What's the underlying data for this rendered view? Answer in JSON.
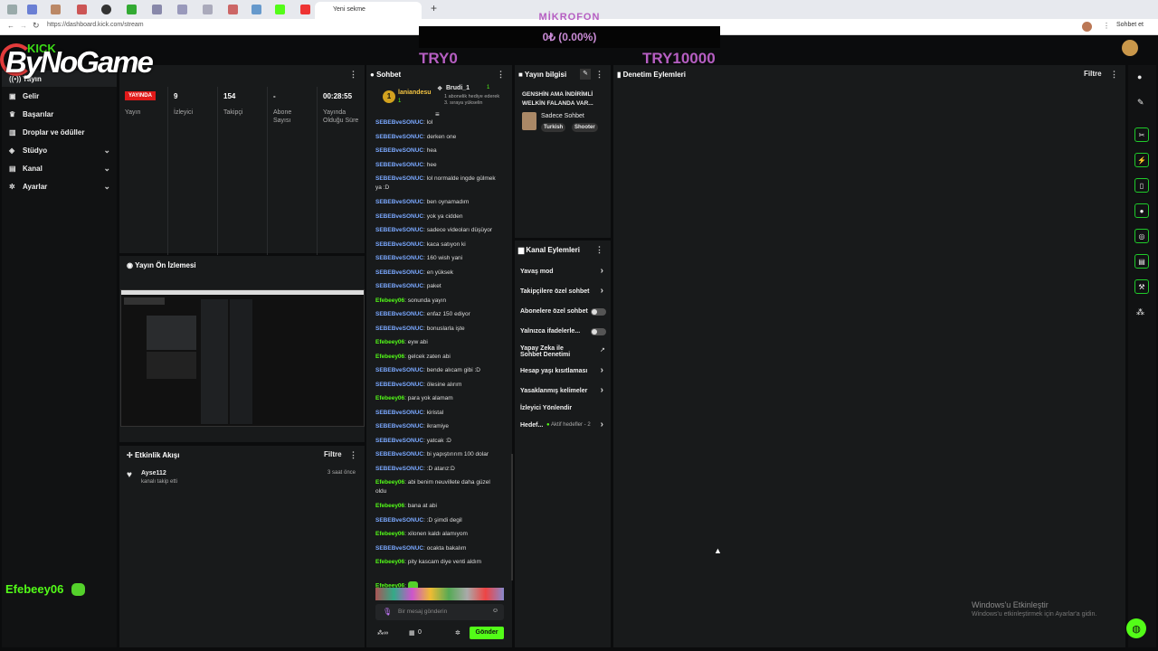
{
  "browser": {
    "active_tab": "Yeni sekme",
    "url": "https://dashboard.kick.com/stream",
    "profile_button": "Sohbet et"
  },
  "overlay": {
    "mikrofon": "MİKROFON",
    "progress_text": "0₺ (0.00%)",
    "progress": 0,
    "min": "TRY0",
    "max": "TRY10000",
    "logo": "ByNoGame",
    "logo_small": "KICK"
  },
  "sidebar": {
    "items": [
      {
        "label": "Yayın",
        "icon": "broadcast-icon"
      },
      {
        "label": "Gelir",
        "icon": "money-icon"
      },
      {
        "label": "Başarılar",
        "icon": "trophy-icon"
      },
      {
        "label": "Droplar ve ödüller",
        "icon": "gift-icon"
      },
      {
        "label": "Stüdyo",
        "icon": "studio-icon"
      },
      {
        "label": "Kanal",
        "icon": "channel-icon"
      },
      {
        "label": "Ayarlar",
        "icon": "gear-icon"
      }
    ],
    "user": "Efebeey06"
  },
  "stats": {
    "live_badge": "YAYINDA",
    "broadcast_label": "Yayın",
    "viewers": "9",
    "viewers_label": "İzleyici",
    "followers": "154",
    "followers_label": "Takipçi",
    "subs": "-",
    "subs_label": "Abone Sayısı",
    "duration": "00:28:55",
    "duration_label": "Yayında Olduğu Süre"
  },
  "preview": {
    "title": "Yayın Ön İzlemesi"
  },
  "activity": {
    "title": "Etkinlik Akışı",
    "filter": "Filtre",
    "items": [
      {
        "user": "Ayse112",
        "text": "kanalı takip etti",
        "time": "3 saat önce"
      }
    ]
  },
  "chat": {
    "title": "Sohbet",
    "pinned_user": "laniandesu",
    "pinned_count": "1",
    "gift_user": "Brudi_1",
    "gift_count": "1",
    "gift_text": "1 abonelik hediye ederek 3. sıraya yükselin",
    "messages": [
      [
        "SEBEBveSONUC",
        "lol"
      ],
      [
        "SEBEBveSONUC",
        "derken one"
      ],
      [
        "SEBEBveSONUC",
        "hea"
      ],
      [
        "SEBEBveSONUC",
        "hee"
      ],
      [
        "SEBEBveSONUC",
        "lol normalde ingde gülmek ya :D"
      ],
      [
        "SEBEBveSONUC",
        "ben oynamadım"
      ],
      [
        "SEBEBveSONUC",
        "yok ya cidden"
      ],
      [
        "SEBEBveSONUC",
        "sadece videoları düşüyor"
      ],
      [
        "SEBEBveSONUC",
        "kaca satıyon ki"
      ],
      [
        "SEBEBveSONUC",
        "160 wish yani"
      ],
      [
        "SEBEBveSONUC",
        "en yüksek"
      ],
      [
        "SEBEBveSONUC",
        "paket"
      ],
      [
        "Efebeey06",
        "sonunda yayın"
      ],
      [
        "SEBEBveSONUC",
        "enfaz 150 ediyor"
      ],
      [
        "SEBEBveSONUC",
        "bonuslarla işte"
      ],
      [
        "Efebeey06",
        "eyw abi"
      ],
      [
        "Efebeey06",
        "gelcek zaten abi"
      ],
      [
        "SEBEBveSONUC",
        "bende alıcam gibi :D"
      ],
      [
        "SEBEBveSONUC",
        "ölesine alırım"
      ],
      [
        "Efebeey06",
        "para yok alamam"
      ],
      [
        "SEBEBveSONUC",
        "kiristal"
      ],
      [
        "SEBEBveSONUC",
        "ikramiye"
      ],
      [
        "SEBEBveSONUC",
        "yatcak :D"
      ],
      [
        "SEBEBveSONUC",
        "bi yapıştırırım 100 dolar"
      ],
      [
        "SEBEBveSONUC",
        ":D atarız:D"
      ],
      [
        "Efebeey06",
        "abi benim neuvillete daha güzel oldu"
      ],
      [
        "Efebeey06",
        "bana at abi"
      ],
      [
        "SEBEBveSONUC",
        ":D şimdi degil"
      ],
      [
        "Efebeey06",
        "xilonen kaldı alamıyom"
      ],
      [
        "SEBEBveSONUC",
        "ocakta bakalım"
      ],
      [
        "Efebeey06",
        "pity kascam diye venti aldım"
      ],
      [
        "Efebeey06",
        ""
      ]
    ],
    "input_placeholder": "Bir mesaj gönderin",
    "points": "0",
    "send": "Gönder"
  },
  "stream_info": {
    "title": "Yayın bilgisi",
    "stream_title": "GENSHİN AMA İNDİRİMLİ WELKİN FALANDA VAR...",
    "category": "Sadece Sohbet",
    "tags": [
      "Turkish",
      "Shooter"
    ]
  },
  "channel_actions": {
    "title": "Kanal Eylemleri",
    "items": [
      "Yavaş mod",
      "Takipçilere özel sohbet",
      "Abonelere özel sohbet",
      "Yalnızca ifadelerle...",
      "Yapay Zeka ile Sohbet Denetimi",
      "Hesap yaşı kısıtlaması",
      "Yasaklanmış kelimeler",
      "İzleyici Yönlendir",
      "Hedef..."
    ],
    "goal_text": "Aktif hedefler - 2"
  },
  "moderation": {
    "title": "Denetim Eylemleri",
    "filter": "Filtre"
  },
  "windows": {
    "line1": "Windows'u Etkinleştir",
    "line2": "Windows'u etkinleştirmek için Ayarlar'a gidin."
  }
}
